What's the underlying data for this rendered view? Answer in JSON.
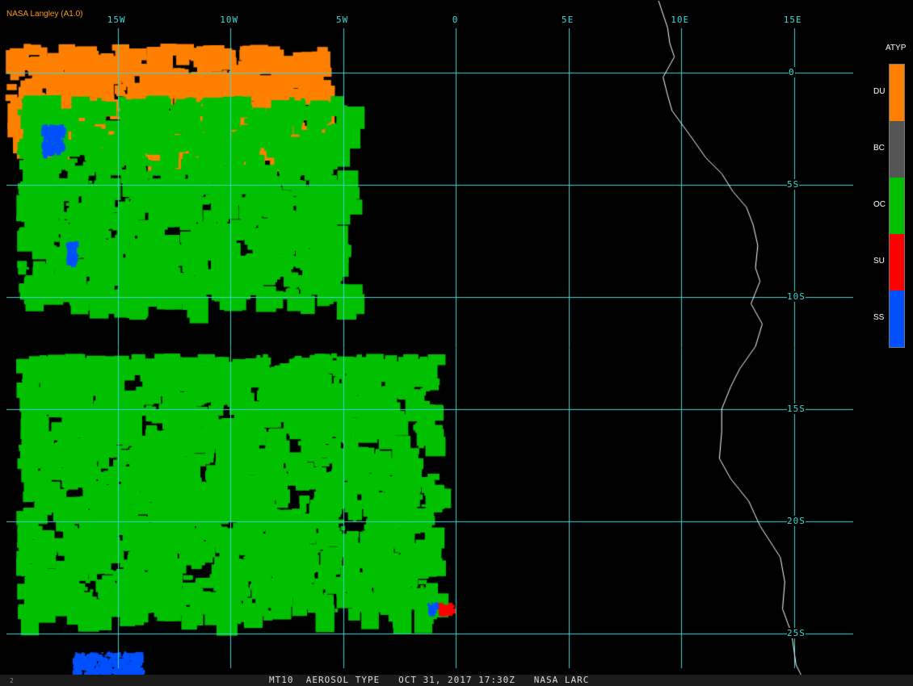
{
  "credit": "NASA Langley (A1.0)",
  "status_text": "MT10  AEROSOL TYPE   OCT 31, 2017 17:30Z   NASA LARC",
  "frame_number": "2",
  "grid": {
    "color": "#41d6d6",
    "longitudes": [
      {
        "deg": -15,
        "label": "15W"
      },
      {
        "deg": -10,
        "label": "10W"
      },
      {
        "deg": -5,
        "label": "5W"
      },
      {
        "deg": 0,
        "label": "0"
      },
      {
        "deg": 5,
        "label": "5E"
      },
      {
        "deg": 10,
        "label": "10E"
      },
      {
        "deg": 15,
        "label": "15E"
      }
    ],
    "latitudes": [
      {
        "deg": 0,
        "label": "0"
      },
      {
        "deg": -5,
        "label": "5S"
      },
      {
        "deg": -10,
        "label": "10S"
      },
      {
        "deg": -15,
        "label": "15S"
      },
      {
        "deg": -20,
        "label": "20S"
      },
      {
        "deg": -25,
        "label": "25S"
      }
    ]
  },
  "legend": {
    "title": "ATYP",
    "items": [
      {
        "code": "DU",
        "color": "#ff8000"
      },
      {
        "code": "BC",
        "color": "#555555"
      },
      {
        "code": "OC",
        "color": "#00c000"
      },
      {
        "code": "SU",
        "color": "#ff0000"
      },
      {
        "code": "SS",
        "color": "#0050ff"
      }
    ]
  },
  "aerosol_regions": [
    {
      "type": "DU",
      "lon": [
        -20,
        -5.8
      ],
      "lat": [
        -3.5,
        1.3
      ]
    },
    {
      "type": "OC",
      "lon": [
        -19.5,
        -4.9
      ],
      "lat": [
        -10,
        -1
      ]
    },
    {
      "type": "OC",
      "lon": [
        -19.5,
        -1.1
      ],
      "lat": [
        -24,
        -12.5
      ]
    },
    {
      "type": "SS",
      "lon": [
        -18.4,
        -17.5
      ],
      "lat": [
        -3.6,
        -2.3
      ]
    },
    {
      "type": "SS",
      "lon": [
        -17.3,
        -16.9
      ],
      "lat": [
        -8.4,
        -7.5
      ]
    },
    {
      "type": "SS",
      "lon": [
        -1.3,
        -0.9
      ],
      "lat": [
        -24.1,
        -23.6
      ]
    },
    {
      "type": "SU",
      "lon": [
        -0.8,
        -0.2
      ],
      "lat": [
        -24,
        -23.6
      ]
    },
    {
      "type": "SS",
      "lon": [
        -17,
        -14
      ],
      "lat": [
        -26.8,
        -25.8
      ]
    }
  ],
  "coastline": {
    "color": "#ffffff",
    "points": [
      [
        9.0,
        3.2
      ],
      [
        9.4,
        2.0
      ],
      [
        9.5,
        1.3
      ],
      [
        9.7,
        0.7
      ],
      [
        9.2,
        -0.2
      ],
      [
        9.4,
        -1.0
      ],
      [
        9.6,
        -1.7
      ],
      [
        10.4,
        -2.8
      ],
      [
        11.1,
        -3.8
      ],
      [
        11.8,
        -4.5
      ],
      [
        12.3,
        -5.3
      ],
      [
        12.9,
        -6.0
      ],
      [
        13.2,
        -6.8
      ],
      [
        13.4,
        -7.7
      ],
      [
        13.3,
        -8.7
      ],
      [
        13.5,
        -9.3
      ],
      [
        13.1,
        -10.3
      ],
      [
        13.6,
        -11.2
      ],
      [
        13.3,
        -12.2
      ],
      [
        12.6,
        -13.2
      ],
      [
        12.2,
        -14.0
      ],
      [
        11.8,
        -15.0
      ],
      [
        11.8,
        -16.0
      ],
      [
        11.7,
        -17.2
      ],
      [
        12.2,
        -18.1
      ],
      [
        13.0,
        -19.1
      ],
      [
        13.5,
        -20.2
      ],
      [
        14.4,
        -21.6
      ],
      [
        14.6,
        -22.7
      ],
      [
        14.5,
        -23.9
      ],
      [
        14.9,
        -25.0
      ],
      [
        15.1,
        -26.4
      ],
      [
        15.4,
        -27.0
      ]
    ]
  }
}
